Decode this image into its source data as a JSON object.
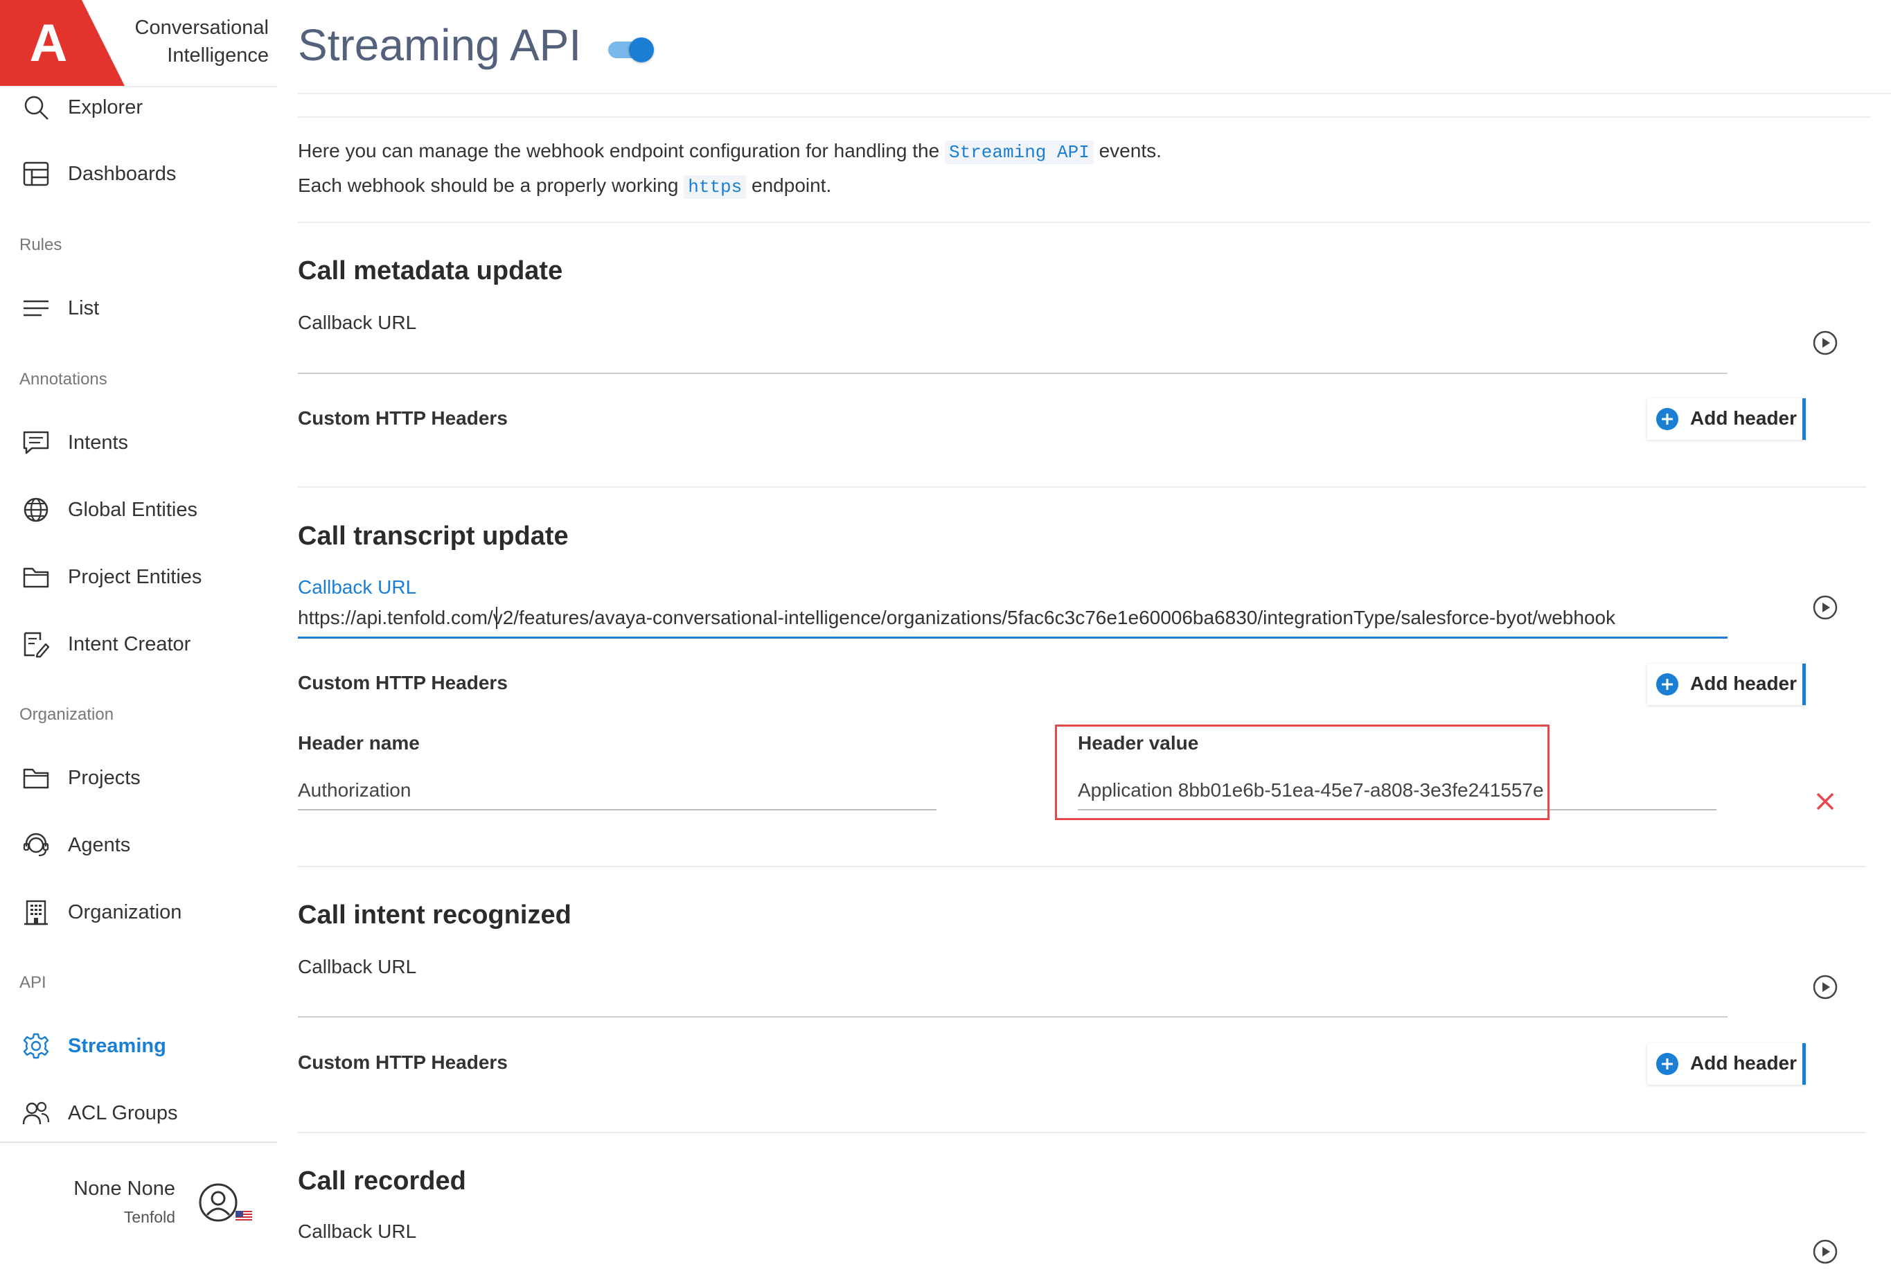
{
  "app": {
    "brand_line1": "Conversational",
    "brand_line2": "Intelligence",
    "logo_letter": "A",
    "brand_color": "#e2332c"
  },
  "sidebar": {
    "items_top": [
      {
        "label": "Explorer",
        "icon": "search-icon"
      },
      {
        "label": "Dashboards",
        "icon": "table-icon"
      }
    ],
    "section_rules": "Rules",
    "rules_items": [
      {
        "label": "List",
        "icon": "list-icon"
      }
    ],
    "section_annotations": "Annotations",
    "annotations_items": [
      {
        "label": "Intents",
        "icon": "chat-icon"
      },
      {
        "label": "Global Entities",
        "icon": "globe-icon"
      },
      {
        "label": "Project Entities",
        "icon": "folder-icon"
      },
      {
        "label": "Intent Creator",
        "icon": "edit-icon"
      }
    ],
    "section_organization": "Organization",
    "organization_items": [
      {
        "label": "Projects",
        "icon": "folder-icon"
      },
      {
        "label": "Agents",
        "icon": "headset-icon"
      },
      {
        "label": "Organization",
        "icon": "building-icon"
      }
    ],
    "section_api": "API",
    "api_items": [
      {
        "label": "Streaming",
        "icon": "gear-icon",
        "active": true
      },
      {
        "label": "ACL Groups",
        "icon": "users-icon"
      }
    ],
    "user": {
      "name": "None None",
      "org": "Tenfold"
    }
  },
  "page": {
    "title": "Streaming API",
    "enabled": true,
    "intro": {
      "line1_before": "Here you can manage the webhook endpoint configuration for handling the",
      "line1_code": "Streaming API",
      "line1_after": "events.",
      "line2_before": "Each webhook should be a properly working",
      "line2_code": "https",
      "line2_after": "endpoint."
    }
  },
  "sections": {
    "call_metadata": {
      "title": "Call metadata update",
      "callback_label": "Callback URL",
      "callback_value": "",
      "headers_label": "Custom HTTP Headers",
      "add_header": "Add header"
    },
    "call_transcript": {
      "title": "Call transcript update",
      "callback_label": "Callback URL",
      "callback_value": "https://api.tenfold.com/v2/features/avaya-conversational-intelligence/organizations/5fac6c3c76e1e60006ba6830/integrationType/salesforce-byot/webhook",
      "headers_label": "Custom HTTP Headers",
      "add_header": "Add header",
      "header_name_label": "Header name",
      "header_name_value": "Authorization",
      "header_value_label": "Header value",
      "header_value_value": "Application 8bb01e6b-51ea-45e7-a808-3e3fe241557e"
    },
    "call_intent": {
      "title": "Call intent recognized",
      "callback_label": "Callback URL",
      "callback_value": "",
      "headers_label": "Custom HTTP Headers",
      "add_header": "Add header"
    },
    "call_recorded": {
      "title": "Call recorded",
      "callback_label": "Callback URL",
      "callback_value": ""
    }
  },
  "colors": {
    "accent": "#1a7fd4",
    "danger": "#e8474c",
    "title": "#53617c"
  }
}
